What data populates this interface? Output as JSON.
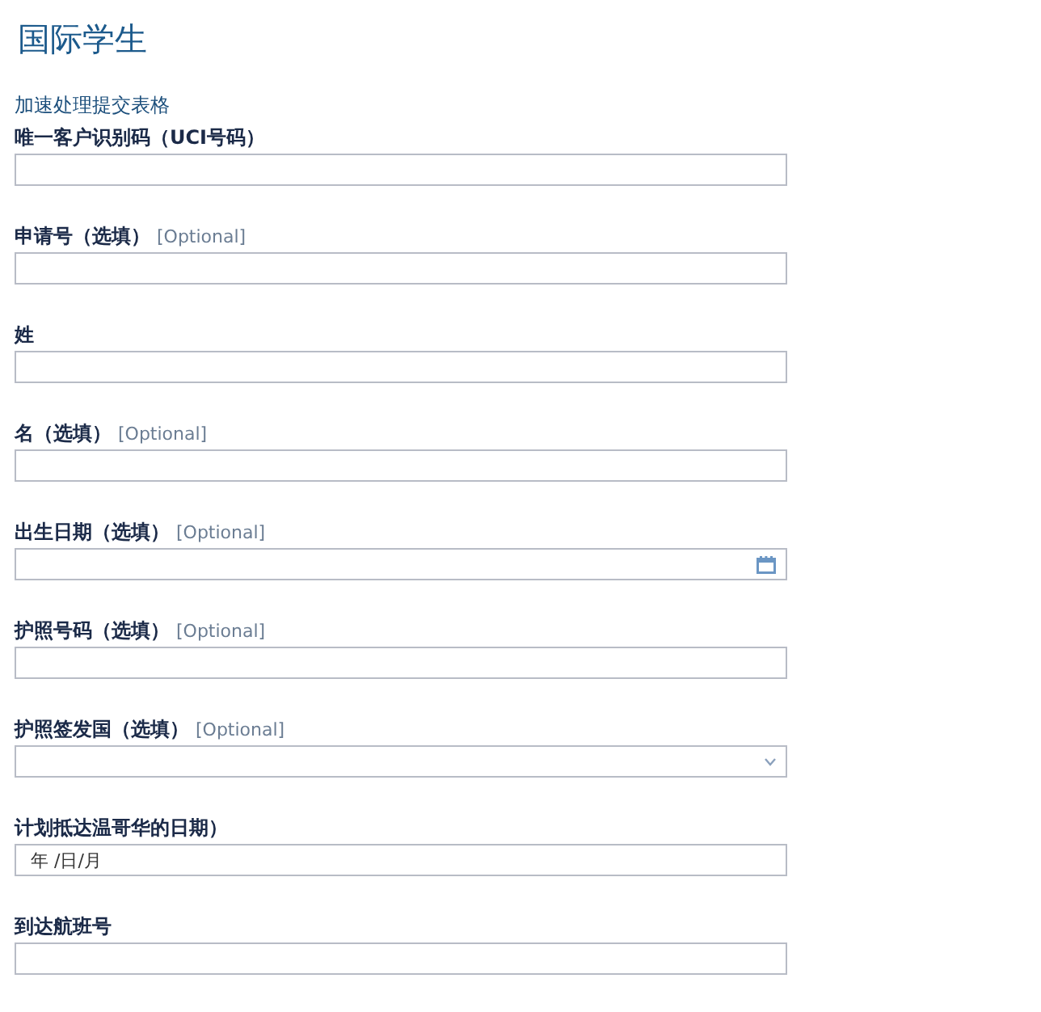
{
  "title": "国际学生",
  "subtitle": "加速处理提交表格",
  "fields": [
    {
      "kind": "text",
      "label": "唯一客户识别码（UCI号码）"
    },
    {
      "kind": "text",
      "label": "申请号（选填）",
      "optional": "[Optional]"
    },
    {
      "kind": "text",
      "label": "姓"
    },
    {
      "kind": "text",
      "label": "名（选填）",
      "optional": "[Optional]"
    },
    {
      "kind": "date",
      "label": "出生日期（选填）",
      "optional": "[Optional]"
    },
    {
      "kind": "text",
      "label": "护照号码（选填）",
      "optional": "[Optional]"
    },
    {
      "kind": "select",
      "label": "护照签发国（选填）",
      "optional": "[Optional]"
    },
    {
      "kind": "native-date",
      "label": "计划抵达温哥华的日期）",
      "placeholder": "年 /日/月"
    },
    {
      "kind": "text",
      "label": "到达航班号"
    }
  ]
}
